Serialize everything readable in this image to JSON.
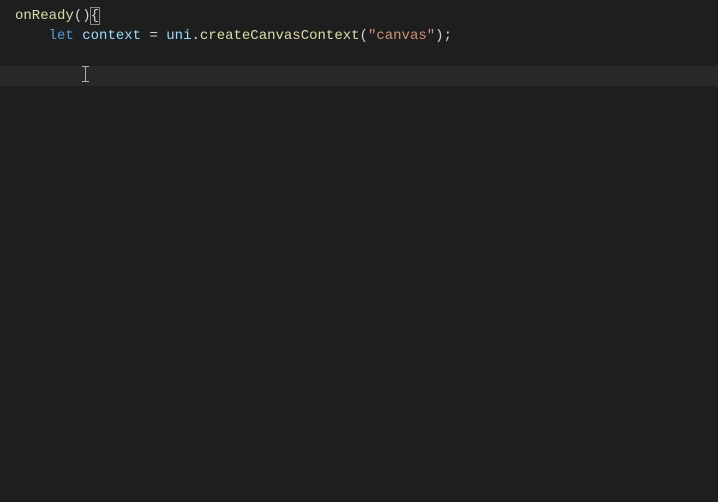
{
  "code": {
    "line1": {
      "fn": "onReady",
      "paren_open": "(",
      "paren_close": ")",
      "brace_open": "{"
    },
    "line2": {
      "indent": "    ",
      "keyword": "let",
      "space1": " ",
      "variable": "context",
      "space2": " ",
      "operator": "=",
      "space3": " ",
      "object": "uni",
      "dot": ".",
      "method": "createCanvasContext",
      "paren_open": "(",
      "string": "\"canvas\"",
      "paren_close": ")",
      "semi": ";"
    },
    "line3": {
      "indent": "    "
    }
  }
}
